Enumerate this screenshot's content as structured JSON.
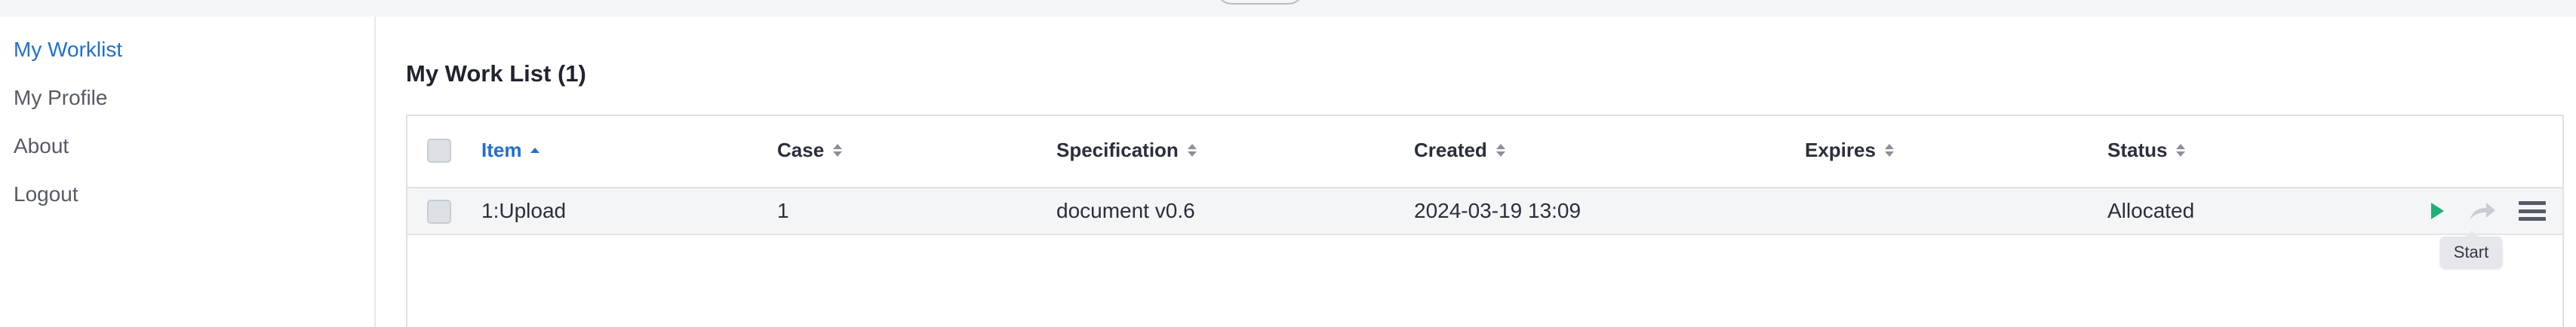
{
  "nav": {
    "items": [
      {
        "label": "My Worklist",
        "active": true
      },
      {
        "label": "My Profile",
        "active": false
      },
      {
        "label": "About",
        "active": false
      },
      {
        "label": "Logout",
        "active": false
      }
    ]
  },
  "page": {
    "title": "My Work List (1)"
  },
  "table": {
    "columns": [
      {
        "label": "Item",
        "sort": "ascending"
      },
      {
        "label": "Case",
        "sort": "none"
      },
      {
        "label": "Specification",
        "sort": "none"
      },
      {
        "label": "Created",
        "sort": "none"
      },
      {
        "label": "Expires",
        "sort": "none"
      },
      {
        "label": "Status",
        "sort": "none"
      }
    ],
    "rows": [
      {
        "item": "1:Upload",
        "case": "1",
        "specification": "document v0.6",
        "created": "2024-03-19 13:09",
        "expires": "",
        "status": "Allocated"
      }
    ],
    "row_actions": {
      "start_icon": "play-icon",
      "forward_icon": "share-forward-icon",
      "menu_icon": "hamburger-menu-icon"
    }
  },
  "tooltip": {
    "text": "Start"
  },
  "colors": {
    "accent": "#1f6fd1",
    "start_green": "#1fb07a",
    "row_bg": "#f4f5f7"
  }
}
